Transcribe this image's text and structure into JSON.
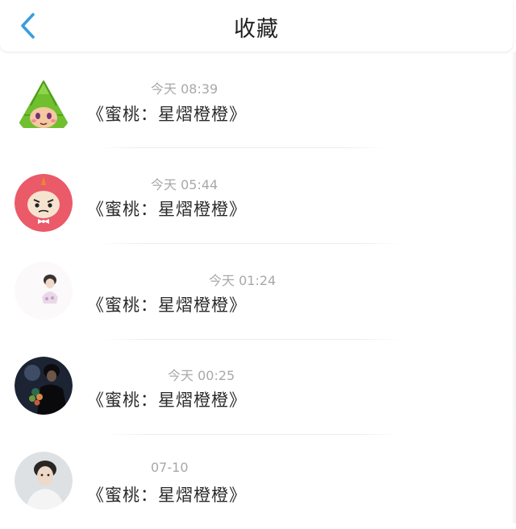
{
  "header": {
    "title": "收藏",
    "back_icon": "chevron-left-icon",
    "accent_color": "#3a9ddf"
  },
  "items": [
    {
      "time": "今天 08:39",
      "text": "《蜜桃：星熠橙橙》",
      "avatar": "zongzi-cartoon-avatar"
    },
    {
      "time": "今天 05:44",
      "text": "《蜜桃：星熠橙橙》",
      "avatar": "little-my-cartoon-avatar"
    },
    {
      "time": "今天 01:24",
      "text": "《蜜桃：星熠橙橙》",
      "avatar": "person-photo-avatar"
    },
    {
      "time": "今天 00:25",
      "text": "《蜜桃：星熠橙橙》",
      "avatar": "person-flowers-photo-avatar"
    },
    {
      "time": "07-10",
      "text": "《蜜桃：星熠橙橙》",
      "avatar": "person-portrait-photo-avatar"
    }
  ]
}
